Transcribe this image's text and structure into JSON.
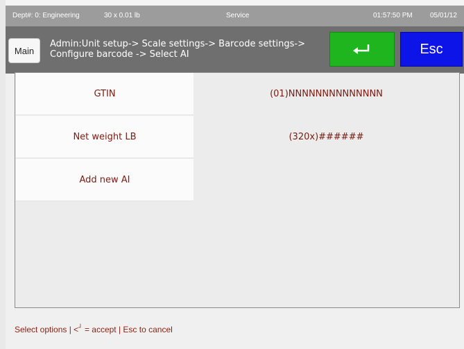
{
  "statusbar": {
    "dept": "Dept#: 0: Engineering",
    "tare": "30 x 0.01 lb",
    "mode": "Service",
    "time": "01:57:50 PM",
    "date": "05/01/12"
  },
  "header": {
    "main_label": "Main",
    "breadcrumb": "Admin:Unit setup-> Scale settings-> Barcode settings-> Configure barcode -> Select AI",
    "accept_icon": "return-arrow-icon",
    "esc_label": "Esc",
    "accept_color": "#1fb51f",
    "esc_color": "#0d14e8"
  },
  "rows": [
    {
      "label": "GTIN",
      "value": "(01)NNNNNNNNNNNNNN"
    },
    {
      "label": "Net weight LB",
      "value": "(320x)######"
    },
    {
      "label": "Add new AI",
      "value": ""
    }
  ],
  "footer": {
    "prefix": "Select options | <",
    "accept_glyph": "┘",
    "suffix": " = accept | Esc to cancel"
  },
  "colors": {
    "text_accent": "#7a1a10",
    "header_bg": "#6f6f6f",
    "statusbar_bg": "#9c9c9c"
  }
}
